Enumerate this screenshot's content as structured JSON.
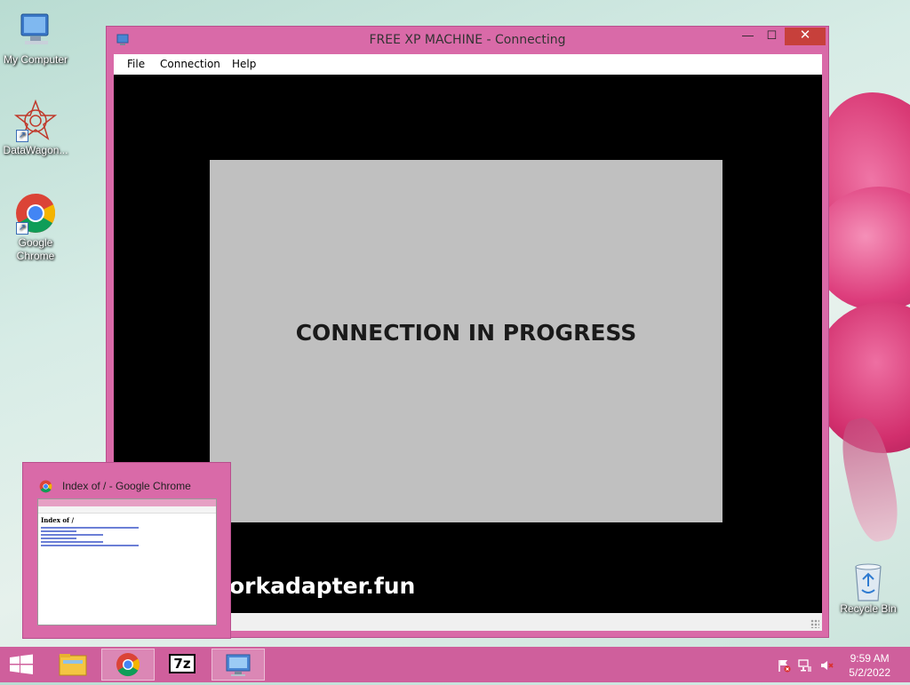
{
  "desktop": {
    "icons": [
      {
        "label": "My Computer"
      },
      {
        "label": "DataWagon..."
      },
      {
        "label": "Google Chrome"
      }
    ],
    "recycle_bin": {
      "label": "Recycle Bin"
    }
  },
  "window": {
    "title": "FREE XP MACHINE - Connecting",
    "buttons": {
      "minimize": "—",
      "maximize": "☐",
      "close": "✕"
    },
    "menu": [
      "File",
      "Connection",
      "Help"
    ],
    "content": {
      "status_text": "CONNECTION IN PROGRESS",
      "watermark": "orkadapter.fun"
    }
  },
  "preview": {
    "title": "Index of / - Google Chrome",
    "page_heading": "Index of /"
  },
  "taskbar": {
    "items": [
      {
        "icon": "file-explorer-icon"
      },
      {
        "icon": "chrome-icon"
      },
      {
        "icon": "7zip-icon",
        "label": "7z"
      },
      {
        "icon": "remote-desktop-icon"
      }
    ],
    "clock": {
      "time": "9:59 AM",
      "date": "5/2/2022"
    }
  },
  "colors": {
    "accent": "#d96aa8",
    "taskbar": "#cf5f9c",
    "close_button": "#c7403b",
    "connection_panel": "#c0c0c0"
  }
}
